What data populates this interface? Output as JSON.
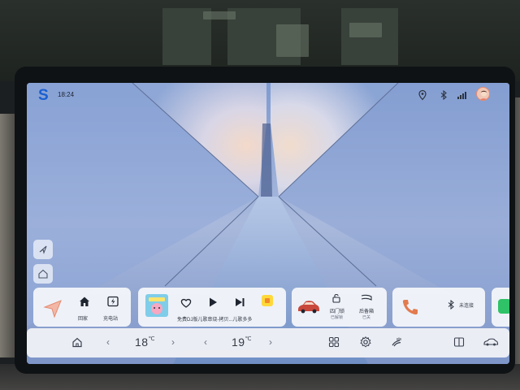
{
  "status_bar": {
    "time": "18:24",
    "icons": [
      "location-icon",
      "bluetooth-icon",
      "cellular-signal-icon"
    ]
  },
  "side_buttons": [
    "compass-icon",
    "home-outline-icon"
  ],
  "nav_card": {
    "home_label": "回家",
    "charging_label": "充电站"
  },
  "media_card": {
    "song_text": "免费DJ版儿歌串烧-拷贝...儿歌多多",
    "controls": [
      "heart-icon",
      "play-icon",
      "next-track-icon"
    ]
  },
  "vehicle_card": {
    "door_label": "四门锁",
    "door_state": "已解锁",
    "trunk_label": "后备箱",
    "trunk_state": "已关"
  },
  "phone_card": {
    "bt_status": "未连接"
  },
  "bottom_bar": {
    "left_temp": "18",
    "right_temp": "19",
    "temp_unit": "℃"
  },
  "colors": {
    "accent_blue": "#1a5fd1",
    "phone_orange": "#e27b4e",
    "car_red": "#c8483b",
    "card_bg": "#f3f5fa"
  }
}
